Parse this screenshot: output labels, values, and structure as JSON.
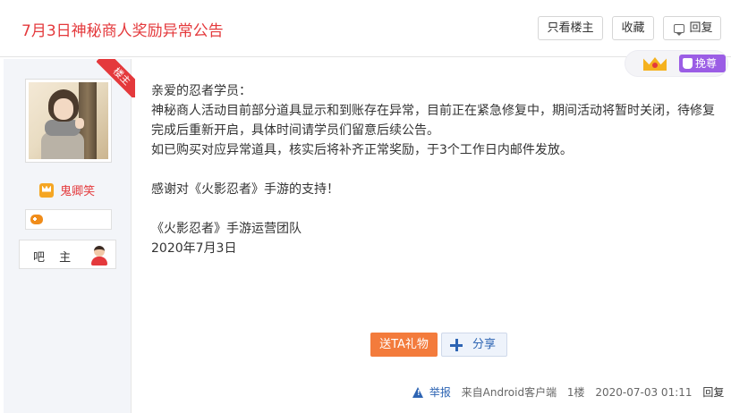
{
  "header": {
    "title": "7月3日神秘商人奖励异常公告",
    "only_lz_label": "只看楼主",
    "favorite_label": "收藏",
    "reply_label": "回复"
  },
  "author": {
    "lz_tag": "楼主",
    "avatar_icon": "avatar-photo",
    "name": "鬼卿笑",
    "name_icon": "vip-crown-icon",
    "game_icon": "gamepad-icon",
    "role_label": "吧 主",
    "role_icon": "user-icon"
  },
  "vip_badge": {
    "crown_icon": "crown-icon",
    "label": "挽尊"
  },
  "post": {
    "lines": [
      "亲爱的忍者学员：",
      "神秘商人活动目前部分道具显示和到账存在异常，目前正在紧急修复中，期间活动将暂时关闭，待修复完成后重新开启，具体时间请学员们留意后续公告。",
      "如已购买对应异常道具，核实后将补齐正常奖励，于3个工作日内邮件发放。",
      "",
      "感谢对《火影忍者》手游的支持！",
      "",
      "《火影忍者》手游运营团队",
      "2020年7月3日"
    ]
  },
  "actions": {
    "gift_label": "送TA礼物",
    "share_label": "分享"
  },
  "meta": {
    "report_label": "举报",
    "source": "来自Android客户端",
    "floor": "1楼",
    "time": "2020-07-03 01:11",
    "reply_label": "回复"
  },
  "colors": {
    "accent_red": "#e4393c",
    "link_blue": "#2d64b3",
    "gift_orange": "#f37b3c",
    "vip_purple": "#9b5de5"
  }
}
